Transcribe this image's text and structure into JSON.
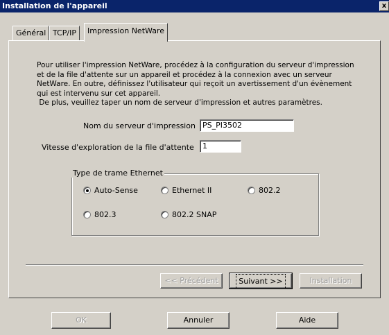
{
  "window": {
    "title": "Installation de l'appareil",
    "close_label": "x"
  },
  "tabs": [
    {
      "label": "Général"
    },
    {
      "label": "TCP/IP"
    },
    {
      "label": "Impression NetWare",
      "active": true
    }
  ],
  "description": {
    "lines": [
      "Pour utiliser l'impression NetWare, procédez à la configuration du serveur d'impression",
      "et de la file d'attente sur un appareil et procédez à la connexion avec un serveur",
      "NetWare. En outre, définissez l'utilisateur qui reçoit un avertissement d'un évènement",
      "qui est intervenu sur cet appareil.",
      " De plus, veuillez taper un nom de serveur d'impression et autres paramètres."
    ]
  },
  "print_server": {
    "label": "Nom du serveur d'impression",
    "value": "PS_PI3502"
  },
  "poll_speed": {
    "label": "Vitesse d'exploration de la file d'attente",
    "value": "1"
  },
  "frame_type": {
    "legend": "Type de trame Ethernet",
    "options": [
      {
        "label": "Auto-Sense",
        "checked": true
      },
      {
        "label": "Ethernet II",
        "checked": false
      },
      {
        "label": "802.2",
        "checked": false
      },
      {
        "label": "802.3",
        "checked": false
      },
      {
        "label": "802.2 SNAP",
        "checked": false
      }
    ]
  },
  "wizard_buttons": {
    "previous": "<< Précédent",
    "next": "Suivant >>",
    "install": "Installation"
  },
  "dialog_buttons": {
    "ok": "OK",
    "cancel": "Annuler",
    "help": "Aide"
  }
}
